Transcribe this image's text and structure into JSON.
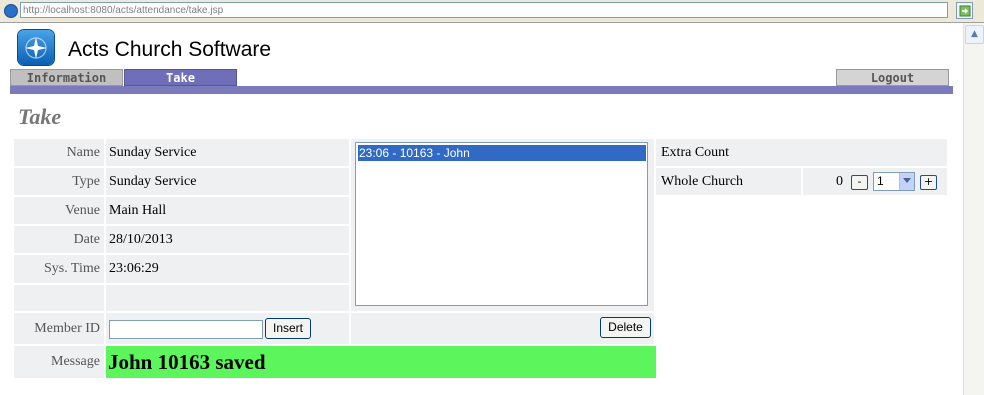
{
  "browser": {
    "url": "http://localhost:8080/acts/attendance/take.jsp"
  },
  "header": {
    "app_title": "Acts Church Software"
  },
  "tabs": {
    "information": "Information",
    "take": "Take",
    "logout": "Logout"
  },
  "page": {
    "heading": "Take"
  },
  "form": {
    "name_label": "Name",
    "name_value": "Sunday Service",
    "type_label": "Type",
    "type_value": "Sunday Service",
    "venue_label": "Venue",
    "venue_value": "Main Hall",
    "date_label": "Date",
    "date_value": "28/10/2013",
    "systime_label": "Sys. Time",
    "systime_value": "23:06:29",
    "member_label": "Member ID",
    "member_value": "",
    "insert_label": "Insert",
    "message_label": "Message",
    "message_value": "John 10163 saved"
  },
  "attendance_list": {
    "items": [
      "23:06 - 10163 - John"
    ],
    "delete_label": "Delete"
  },
  "extra_count": {
    "header": "Extra Count",
    "rows": [
      {
        "label": "Whole Church",
        "count": "0",
        "minus": "-",
        "plus": "+",
        "step_value": "1"
      }
    ]
  },
  "colors": {
    "tab_active": "#6f6fb9",
    "tab_rule": "#7a7abd",
    "message_bg": "#5cf55c",
    "selection": "#316ac5"
  }
}
